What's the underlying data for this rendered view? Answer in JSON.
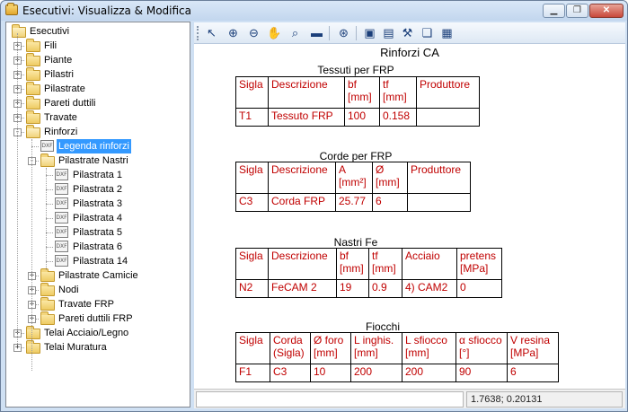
{
  "window": {
    "title": "Esecutivi: Visualizza & Modifica",
    "minimize_glyph": "▁",
    "maximize_glyph": "❐",
    "close_glyph": "✕"
  },
  "tree": {
    "root": "Esecutivi",
    "items": [
      {
        "label": "Fili",
        "level": 1,
        "type": "folder",
        "expander": "+"
      },
      {
        "label": "Piante",
        "level": 1,
        "type": "folder",
        "expander": "+"
      },
      {
        "label": "Pilastri",
        "level": 1,
        "type": "folder",
        "expander": "+"
      },
      {
        "label": "Pilastrate",
        "level": 1,
        "type": "folder",
        "expander": "+"
      },
      {
        "label": "Pareti duttili",
        "level": 1,
        "type": "folder",
        "expander": "+"
      },
      {
        "label": "Travate",
        "level": 1,
        "type": "folder",
        "expander": "+"
      },
      {
        "label": "Rinforzi",
        "level": 1,
        "type": "folder",
        "expander": "-"
      },
      {
        "label": "Legenda rinforzi",
        "level": 2,
        "type": "dxf",
        "selected": true
      },
      {
        "label": "Pilastrate Nastri",
        "level": 2,
        "type": "folder",
        "expander": "-"
      },
      {
        "label": "Pilastrata 1",
        "level": 3,
        "type": "dxf"
      },
      {
        "label": "Pilastrata 2",
        "level": 3,
        "type": "dxf"
      },
      {
        "label": "Pilastrata 3",
        "level": 3,
        "type": "dxf"
      },
      {
        "label": "Pilastrata 4",
        "level": 3,
        "type": "dxf"
      },
      {
        "label": "Pilastrata 5",
        "level": 3,
        "type": "dxf"
      },
      {
        "label": "Pilastrata 6",
        "level": 3,
        "type": "dxf"
      },
      {
        "label": "Pilastrata 14",
        "level": 3,
        "type": "dxf"
      },
      {
        "label": "Pilastrate Camicie",
        "level": 2,
        "type": "folder",
        "expander": "+"
      },
      {
        "label": "Nodi",
        "level": 2,
        "type": "folder",
        "expander": "+"
      },
      {
        "label": "Travate FRP",
        "level": 2,
        "type": "folder",
        "expander": "+"
      },
      {
        "label": "Pareti duttili FRP",
        "level": 2,
        "type": "folder",
        "expander": "+"
      },
      {
        "label": "Telai Acciaio/Legno",
        "level": 1,
        "type": "folder",
        "expander": "+"
      },
      {
        "label": "Telai Muratura",
        "level": 1,
        "type": "folder",
        "expander": "+"
      }
    ],
    "dxf_icon_text": "DXF"
  },
  "toolbar": {
    "buttons": [
      {
        "name": "pointer-icon",
        "glyph": "↖"
      },
      {
        "name": "zoom-in-icon",
        "glyph": "⊕"
      },
      {
        "name": "zoom-out-icon",
        "glyph": "⊖"
      },
      {
        "name": "pan-hand-icon",
        "glyph": "✋"
      },
      {
        "name": "zoom-window-icon",
        "glyph": "⌕"
      },
      {
        "name": "measure-ruler-icon",
        "glyph": "▬"
      },
      {
        "name": "zoom-extents-icon",
        "glyph": "⊛"
      },
      {
        "name": "save-icon",
        "glyph": "▣"
      },
      {
        "name": "save-as-icon",
        "glyph": "▤"
      },
      {
        "name": "settings-tools-icon",
        "glyph": "⚒"
      },
      {
        "name": "copy-icon",
        "glyph": "❏"
      },
      {
        "name": "paste-icon",
        "glyph": "▦"
      }
    ]
  },
  "document": {
    "title": "Rinforzi CA",
    "sections": [
      {
        "title": "Tessuti per FRP",
        "header": [
          "Sigla",
          "Descrizione",
          "bf\n[mm]",
          "tf\n[mm]",
          "Produttore"
        ],
        "rows": [
          [
            "T1",
            "Tessuto FRP",
            "100",
            "0.158",
            ""
          ]
        ]
      },
      {
        "title": "Corde per FRP",
        "header": [
          "Sigla",
          "Descrizione",
          "A\n[mm²]",
          "Ø\n[mm]",
          "Produttore"
        ],
        "rows": [
          [
            "C3",
            "Corda FRP",
            "25.77",
            "6",
            ""
          ]
        ]
      },
      {
        "title": "Nastri Fe",
        "header": [
          "Sigla",
          "Descrizione",
          "bf\n[mm]",
          "tf\n[mm]",
          "Acciaio",
          "pretens\n[MPa]"
        ],
        "rows": [
          [
            "N2",
            "FeCAM 2",
            "19",
            "0.9",
            "4) CAM2",
            "0"
          ]
        ]
      },
      {
        "title": "Fiocchi",
        "header": [
          "Sigla",
          "Corda\n(Sigla)",
          "Ø foro\n[mm]",
          "L inghis.\n[mm]",
          "L sfiocco\n[mm]",
          "α sfiocco\n[°]",
          "V resina\n[MPa]"
        ],
        "rows": [
          [
            "F1",
            "C3",
            "10",
            "200",
            "200",
            "90",
            "6"
          ]
        ]
      }
    ]
  },
  "statusbar": {
    "left_text": "",
    "coordinates": "1.7638; 0.20131"
  }
}
